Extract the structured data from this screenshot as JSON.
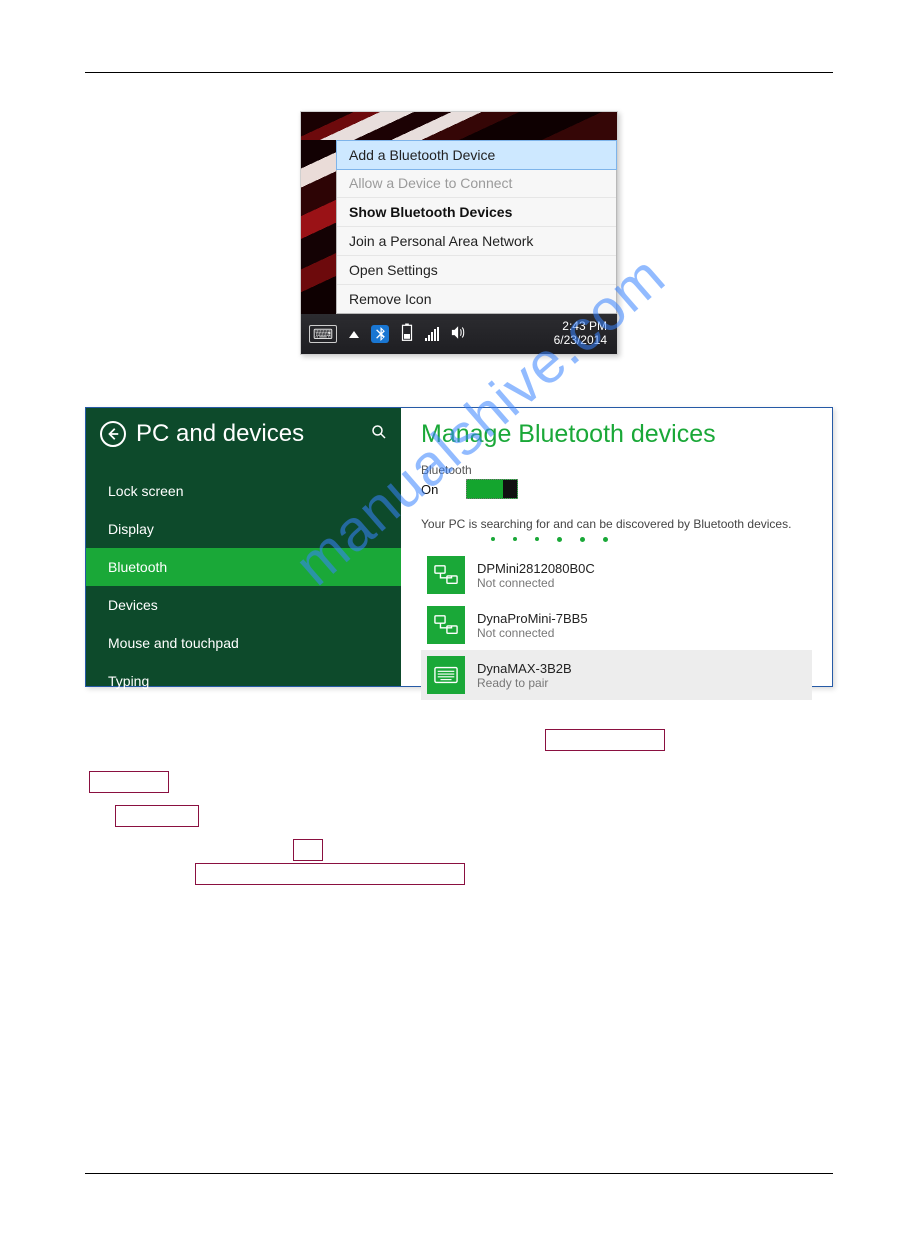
{
  "context_menu": {
    "items": [
      {
        "label": "Add a Bluetooth Device",
        "state": "highlighted"
      },
      {
        "label": "Allow a Device to Connect",
        "state": "disabled"
      },
      {
        "label": "Show Bluetooth Devices",
        "state": "bold"
      },
      {
        "label": "Join a Personal Area Network",
        "state": "normal"
      },
      {
        "label": "Open Settings",
        "state": "normal"
      },
      {
        "label": "Remove Icon",
        "state": "normal"
      }
    ]
  },
  "system_tray": {
    "bluetooth_glyph": "⁕",
    "time": "2:43 PM",
    "date": "6/23/2014"
  },
  "settings_panel": {
    "header": "PC and devices",
    "sidebar": [
      {
        "label": "Lock screen",
        "selected": false
      },
      {
        "label": "Display",
        "selected": false
      },
      {
        "label": "Bluetooth",
        "selected": true
      },
      {
        "label": "Devices",
        "selected": false
      },
      {
        "label": "Mouse and touchpad",
        "selected": false
      },
      {
        "label": "Typing",
        "selected": false
      }
    ],
    "pane": {
      "title": "Manage Bluetooth devices",
      "section_label": "Bluetooth",
      "toggle_state": "On",
      "status_text": "Your PC is searching for and can be discovered by Bluetooth devices.",
      "devices": [
        {
          "name": "DPMini2812080B0C",
          "status": "Not connected",
          "icon": "device-pair-icon",
          "selected": false
        },
        {
          "name": "DynaProMini-7BB5",
          "status": "Not connected",
          "icon": "device-pair-icon",
          "selected": false
        },
        {
          "name": "DynaMAX-3B2B",
          "status": "Ready to pair",
          "icon": "keyboard-device-icon",
          "selected": true
        }
      ]
    }
  },
  "watermark": "manualshive.com"
}
